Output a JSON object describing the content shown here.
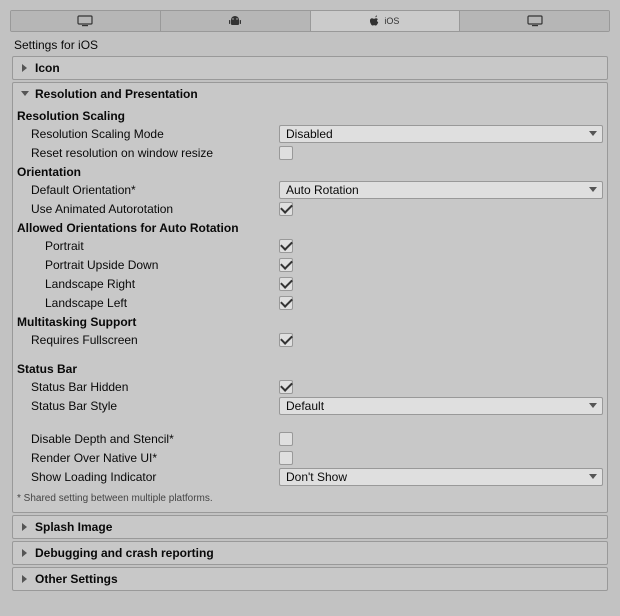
{
  "tabs": {
    "ios_label": "iOS"
  },
  "settings_title": "Settings for iOS",
  "sections": {
    "icon": {
      "title": "Icon"
    },
    "resolution": {
      "title": "Resolution and Presentation",
      "resolution_scaling_header": "Resolution Scaling",
      "resolution_scaling_mode_label": "Resolution Scaling Mode",
      "resolution_scaling_mode_value": "Disabled",
      "reset_resolution_label": "Reset resolution on window resize",
      "orientation_header": "Orientation",
      "default_orientation_label": "Default Orientation*",
      "default_orientation_value": "Auto Rotation",
      "use_animated_autorotation_label": "Use Animated Autorotation",
      "allowed_orientations_header": "Allowed Orientations for Auto Rotation",
      "portrait_label": "Portrait",
      "portrait_upside_down_label": "Portrait Upside Down",
      "landscape_right_label": "Landscape Right",
      "landscape_left_label": "Landscape Left",
      "multitasking_header": "Multitasking Support",
      "requires_fullscreen_label": "Requires Fullscreen",
      "status_bar_header": "Status Bar",
      "status_bar_hidden_label": "Status Bar Hidden",
      "status_bar_style_label": "Status Bar Style",
      "status_bar_style_value": "Default",
      "disable_depth_stencil_label": "Disable Depth and Stencil*",
      "render_over_native_ui_label": "Render Over Native UI*",
      "show_loading_indicator_label": "Show Loading Indicator",
      "show_loading_indicator_value": "Don't Show",
      "shared_note": "* Shared setting between multiple platforms."
    },
    "splash": {
      "title": "Splash Image"
    },
    "debug": {
      "title": "Debugging and crash reporting"
    },
    "other": {
      "title": "Other Settings"
    }
  }
}
